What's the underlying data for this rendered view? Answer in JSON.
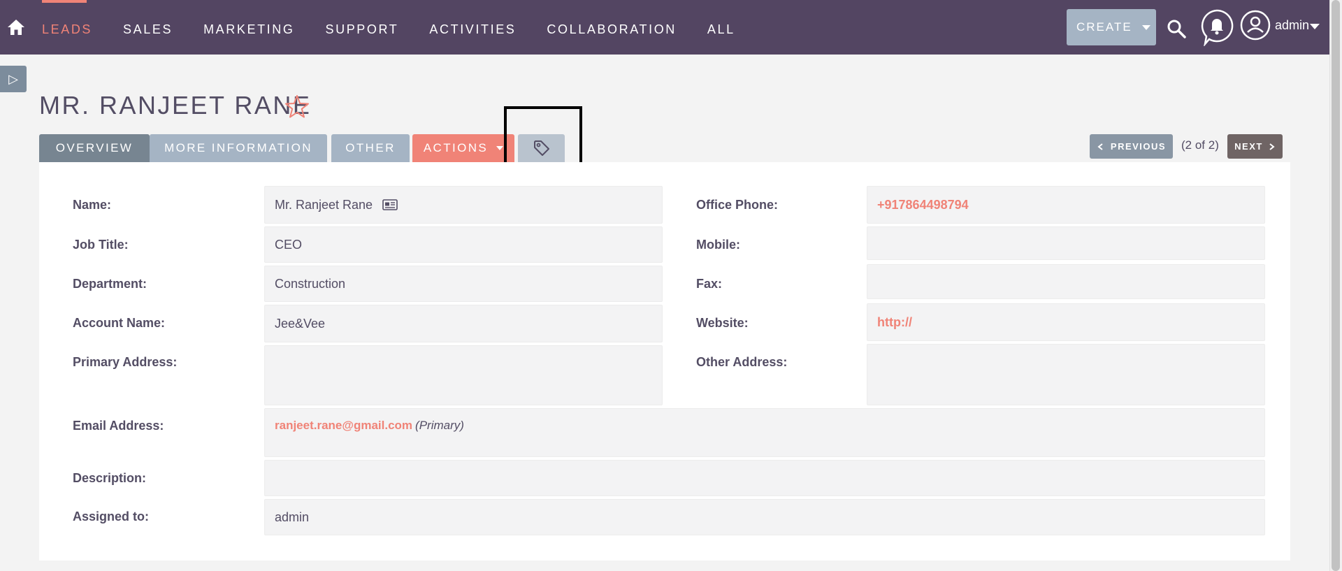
{
  "nav": {
    "items": [
      "LEADS",
      "SALES",
      "MARKETING",
      "SUPPORT",
      "ACTIVITIES",
      "COLLABORATION",
      "ALL"
    ],
    "create_label": "CREATE",
    "user_label": "admin",
    "accent_color": "#f08377",
    "bar_color": "#534562"
  },
  "side_toggle": "▷",
  "record": {
    "title": "MR. RANJEET RANE"
  },
  "tabs": {
    "overview": "OVERVIEW",
    "more_information": "MORE INFORMATION",
    "other": "OTHER",
    "actions": "ACTIONS"
  },
  "pager": {
    "previous": "PREVIOUS",
    "counter": "(2 of 2)",
    "next": "NEXT"
  },
  "fields_left": {
    "name_label": "Name:",
    "name_value": "Mr. Ranjeet Rane",
    "job_title_label": "Job Title:",
    "job_title_value": "CEO",
    "department_label": "Department:",
    "department_value": "Construction",
    "account_name_label": "Account Name:",
    "account_name_value": "Jee&Vee",
    "primary_address_label": "Primary Address:",
    "primary_address_value": ""
  },
  "fields_right": {
    "office_phone_label": "Office Phone:",
    "office_phone_value": "+917864498794",
    "mobile_label": "Mobile:",
    "mobile_value": "",
    "fax_label": "Fax:",
    "fax_value": "",
    "website_label": "Website:",
    "website_value": "http://",
    "other_address_label": "Other Address:",
    "other_address_value": ""
  },
  "fields_wide": {
    "email_label": "Email Address:",
    "email_value": "ranjeet.rane@gmail.com",
    "email_tag": "(Primary)",
    "description_label": "Description:",
    "description_value": "",
    "assigned_label": "Assigned to:",
    "assigned_value": "admin"
  }
}
